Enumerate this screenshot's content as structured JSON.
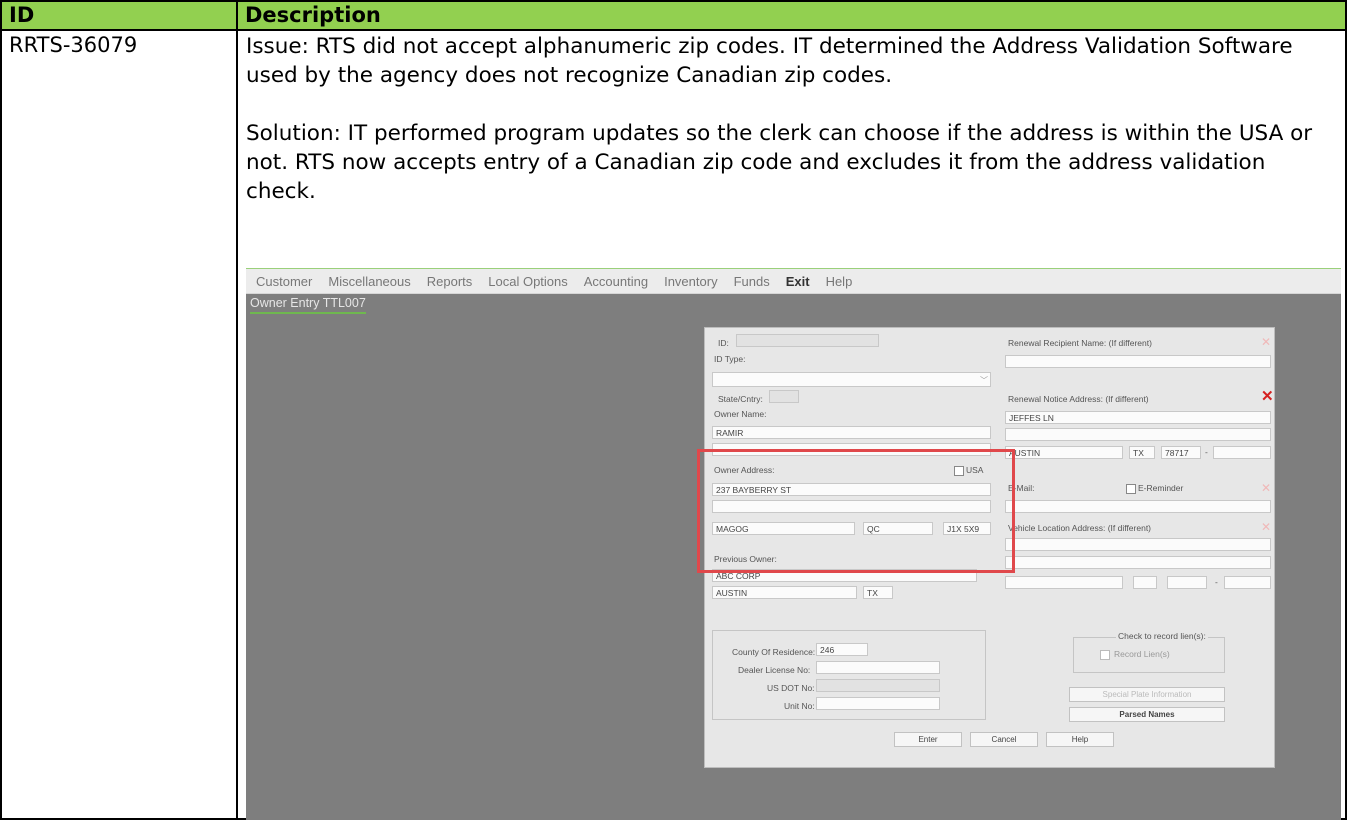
{
  "table": {
    "headers": {
      "id": "ID",
      "description": "Description"
    },
    "row": {
      "id": "RRTS-36079",
      "issue": "Issue: RTS did not accept alphanumeric zip codes. IT determined the Address Validation Software used by the agency does not recognize Canadian zip codes.",
      "solution": "Solution: IT performed program updates so the clerk can choose if the address is within the USA or not. RTS now accepts entry of a Canadian zip code and excludes it from the address validation check."
    }
  },
  "app": {
    "menu": [
      "Customer",
      "Miscellaneous",
      "Reports",
      "Local Options",
      "Accounting",
      "Inventory",
      "Funds",
      "Exit",
      "Help"
    ],
    "screen_title": "Owner Entry TTL007",
    "form": {
      "id_label": "ID:",
      "id_type_label": "ID Type:",
      "state_label": "State/Cntry:",
      "owner_name_label": "Owner Name:",
      "owner_name_value": "RAMIR",
      "owner_address_label": "Owner Address:",
      "usa_label": "USA",
      "street_value": "237 BAYBERRY ST",
      "city_value": "MAGOG",
      "state_value": "QC",
      "zip_value": "J1X 5X9",
      "previous_owner_label": "Previous Owner:",
      "prev_owner_name": "ABC CORP",
      "prev_owner_city": "AUSTIN",
      "prev_owner_state": "TX",
      "county_label": "County Of Residence:",
      "county_value": "246",
      "dealer_label": "Dealer License No:",
      "usdot_label": "US DOT No:",
      "unit_label": "Unit No:",
      "renewal_recipient_label": "Renewal Recipient Name: (If different)",
      "renewal_notice_label": "Renewal Notice Address: (If different)",
      "renewal_street": "JEFFES LN",
      "renewal_city": "AUSTIN",
      "renewal_state": "TX",
      "renewal_zip": "78717",
      "email_label": "E-Mail:",
      "ereminder_label": "E-Reminder",
      "vehicle_location_label": "Vehicle Location Address: (If different)",
      "lien_group_label": "Check to record lien(s):",
      "record_liens_label": "Record Lien(s)",
      "special_plate_label": "Special Plate Information",
      "parsed_names_label": "Parsed Names",
      "enter_label": "Enter",
      "cancel_label": "Cancel",
      "help_label": "Help"
    }
  },
  "colors": {
    "header_green": "#92d050",
    "highlight_red": "#e0484b",
    "app_gray": "#7e7e7e"
  }
}
